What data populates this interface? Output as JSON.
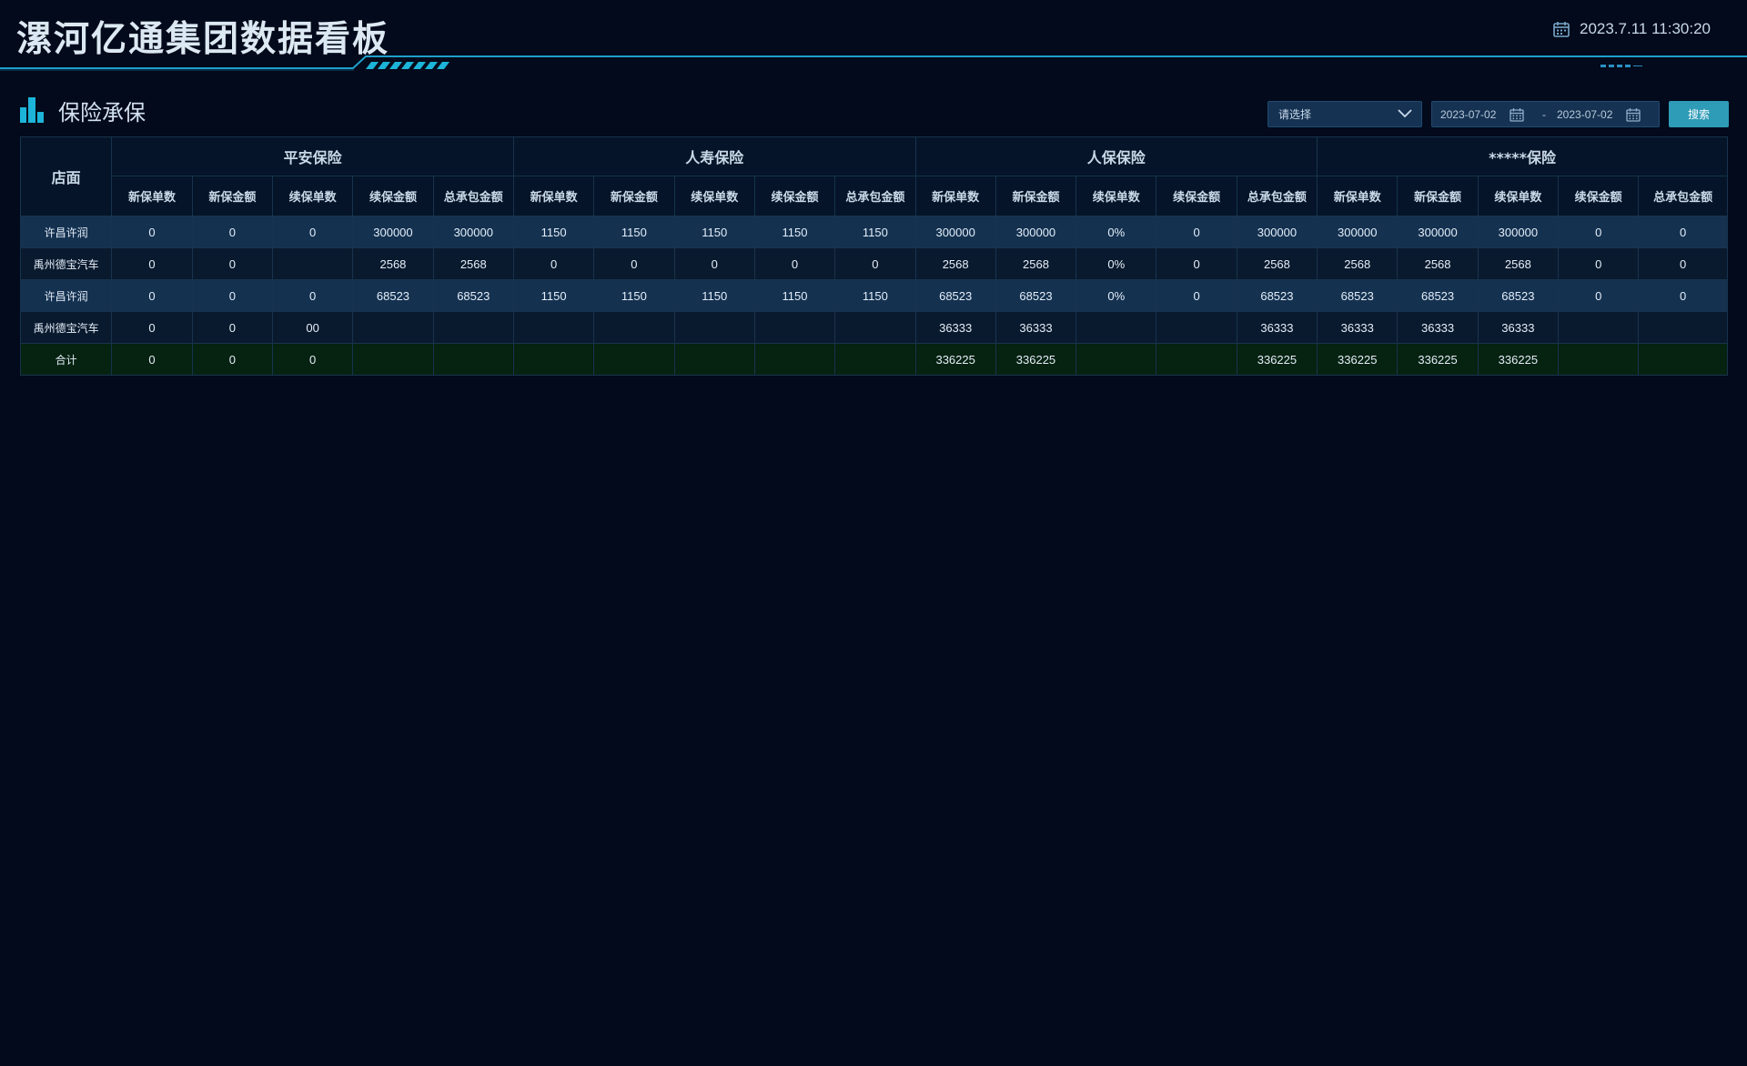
{
  "header": {
    "title": "漯河亿通集团数据看板",
    "datetime": "2023.7.11 11:30:20",
    "calendar_icon": "calendar-icon"
  },
  "section": {
    "title": "保险承保",
    "icon": "bar-chart-icon"
  },
  "filters": {
    "select_placeholder": "请选择",
    "start_date": "2023-07-02",
    "separator": "-",
    "end_date": "2023-07-02",
    "search_label": "搜索"
  },
  "table": {
    "store_header": "店面",
    "groups": [
      "平安保险",
      "人寿保险",
      "人保保险",
      "*****保险"
    ],
    "subheaders": [
      [
        "新保单数",
        "新保金额",
        "续保单数",
        "续保金额",
        "总承包金额"
      ],
      [
        "新保单数",
        "新保金额",
        "续保单数",
        "续保金额",
        "总承包金额"
      ],
      [
        "新保单数",
        "新保金额",
        "续保单数",
        "续保金额",
        "总承包金额"
      ],
      [
        "新保单数",
        "新保金额",
        "续保单数",
        "续保金额",
        "总承包金额"
      ]
    ],
    "rows": [
      {
        "store": "许昌许润",
        "cells": [
          "0",
          "0",
          "0",
          "300000",
          "300000",
          "1150",
          "1150",
          "1150",
          "1150",
          "1150",
          "300000",
          "300000",
          "0%",
          "0",
          "300000",
          "300000",
          "300000",
          "300000",
          "0",
          "0"
        ]
      },
      {
        "store": "禹州德宝汽车",
        "cells": [
          "0",
          "0",
          "",
          "2568",
          "2568",
          "0",
          "0",
          "0",
          "0",
          "0",
          "2568",
          "2568",
          "0%",
          "0",
          "2568",
          "2568",
          "2568",
          "2568",
          "0",
          "0"
        ]
      },
      {
        "store": "许昌许润",
        "cells": [
          "0",
          "0",
          "0",
          "68523",
          "68523",
          "1150",
          "1150",
          "1150",
          "1150",
          "1150",
          "68523",
          "68523",
          "0%",
          "0",
          "68523",
          "68523",
          "68523",
          "68523",
          "0",
          "0"
        ]
      },
      {
        "store": "禹州德宝汽车",
        "cells": [
          "0",
          "0",
          "00",
          "",
          "",
          "",
          "",
          "",
          "",
          "",
          "36333",
          "36333",
          "",
          "",
          "36333",
          "36333",
          "36333",
          "36333",
          "",
          ""
        ]
      },
      {
        "store": "合计",
        "cells": [
          "0",
          "0",
          "0",
          "",
          "",
          "",
          "",
          "",
          "",
          "",
          "336225",
          "336225",
          "",
          "",
          "336225",
          "336225",
          "336225",
          "336225",
          "",
          ""
        ]
      }
    ]
  },
  "colors": {
    "background": "#020a1b",
    "accent": "#1cb4d8",
    "row_highlight": "#143150",
    "total_row": "#062211",
    "button": "#2e9bb7"
  }
}
